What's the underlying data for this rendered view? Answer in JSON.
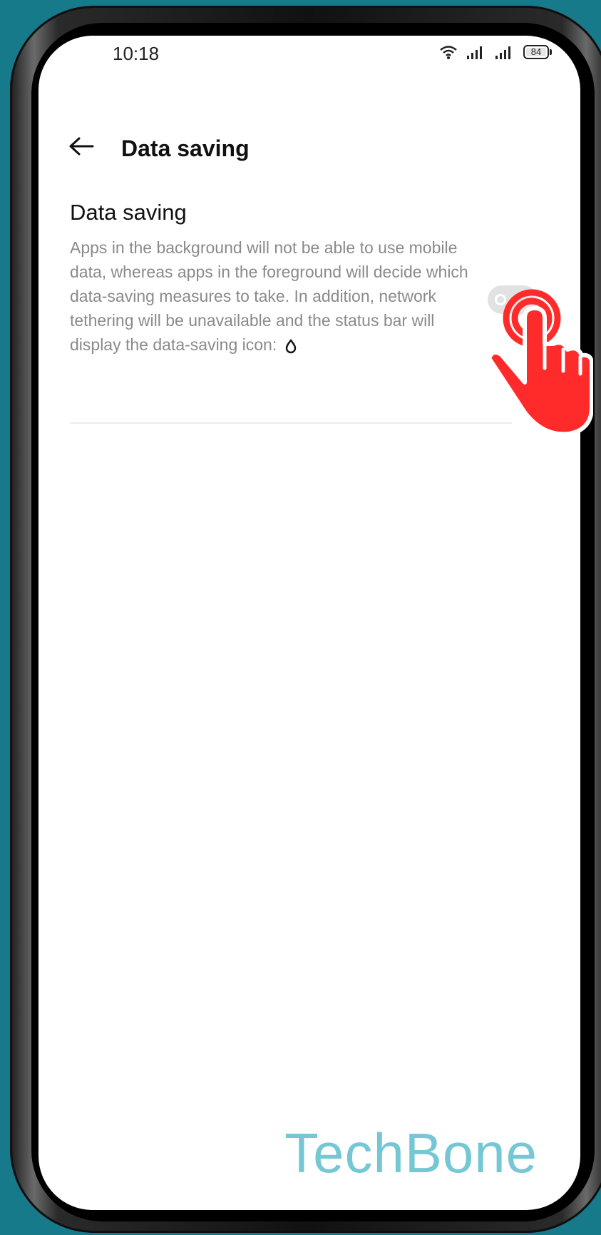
{
  "status_bar": {
    "time": "10:18",
    "battery": "84",
    "icons": [
      "wifi-icon",
      "signal-icon",
      "signal-icon",
      "battery-icon"
    ]
  },
  "header": {
    "title": "Data saving",
    "back_icon": "back-arrow-icon"
  },
  "setting": {
    "title": "Data saving",
    "description": "Apps in the background will not be able to use mobile data, whereas apps in the foreground will decide which data-saving measures to take. In addition, network tethering will be unavailable and the status bar will display the data-saving icon:",
    "description_icon": "data-saver-drop-icon",
    "toggle_state": "off"
  },
  "overlay": {
    "hand_icon": "tap-hand-icon",
    "watermark": "TechBone"
  },
  "colors": {
    "background": "#177a8a",
    "hand": "#ff2a2a",
    "watermark": "#66c2cf"
  }
}
